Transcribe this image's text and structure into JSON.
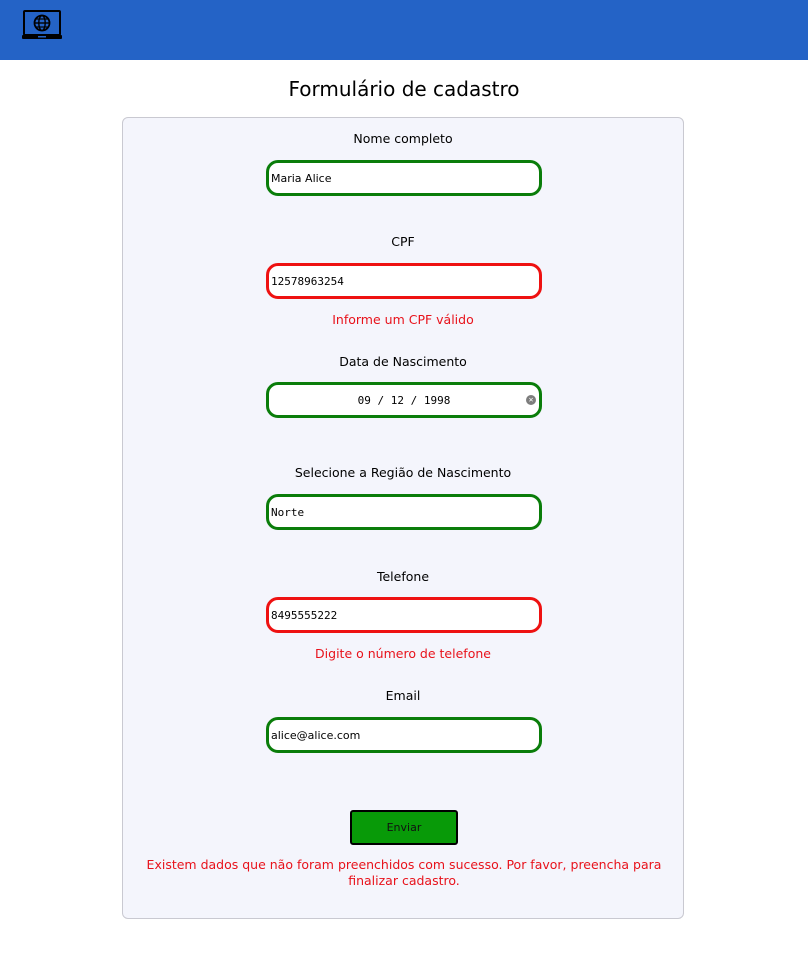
{
  "header": {
    "logo_icon": "laptop-globe-icon",
    "background_color": "#2463c6"
  },
  "page": {
    "title": "Formulário de cadastro"
  },
  "form": {
    "full_name": {
      "label": "Nome completo",
      "value": "Maria Alice",
      "status": "valid"
    },
    "cpf": {
      "label": "CPF",
      "value": "12578963254",
      "status": "invalid",
      "error": "Informe um CPF válido"
    },
    "birth_date": {
      "label": "Data de Nascimento",
      "value": "09 / 12 / 1998",
      "status": "valid",
      "clear_icon": "clear-circle-icon"
    },
    "birth_region": {
      "label": "Selecione a Região de Nascimento",
      "value": "Norte",
      "status": "valid"
    },
    "phone": {
      "label": "Telefone",
      "value": "8495555222",
      "status": "invalid",
      "error": "Digite o número de telefone"
    },
    "email": {
      "label": "Email",
      "value": "alice@alice.com",
      "status": "valid"
    },
    "submit_label": "Enviar",
    "form_error": "Existem dados que não foram preenchidos com sucesso. Por favor, preencha para finalizar cadastro."
  },
  "colors": {
    "valid_border": "#0a7d0a",
    "invalid_border": "#ee1111",
    "error_text": "#e8121b",
    "submit_bg": "#089a08",
    "card_bg": "#f4f5fc"
  }
}
